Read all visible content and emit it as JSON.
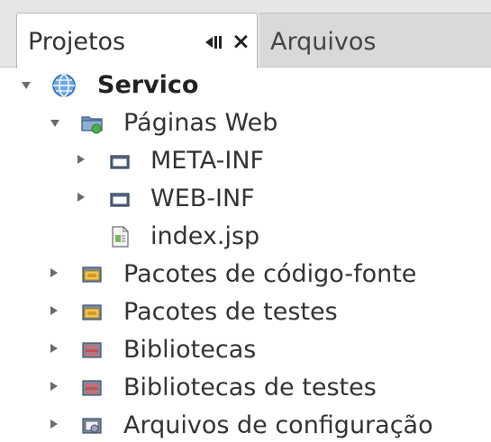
{
  "tabs": {
    "active_label": "Projetos",
    "inactive_label": "Arquivos",
    "close_glyph": "×"
  },
  "tree": {
    "project": "Servico",
    "web_pages": "Páginas Web",
    "meta_inf": "META-INF",
    "web_inf": "WEB-INF",
    "index_file": "index.jsp",
    "source_packages": "Pacotes de código-fonte",
    "test_packages": "Pacotes de testes",
    "libraries": "Bibliotecas",
    "test_libraries": "Bibliotecas de testes",
    "config_files": "Arquivos de configuração"
  },
  "icons": {
    "project": "globe-icon",
    "web_pages": "web-pages-icon",
    "folder": "folder-icon",
    "file": "jsp-file-icon",
    "package": "package-icon",
    "library": "library-icon",
    "config": "config-icon"
  },
  "colors": {
    "tab_strip": "#e6e6e6",
    "active_tab": "#ffffff",
    "inactive_tab": "#d9d9d9",
    "text": "#333333",
    "globe": "#4a90d9",
    "package_yellow": "#e8b84a",
    "library_red": "#d06060"
  }
}
